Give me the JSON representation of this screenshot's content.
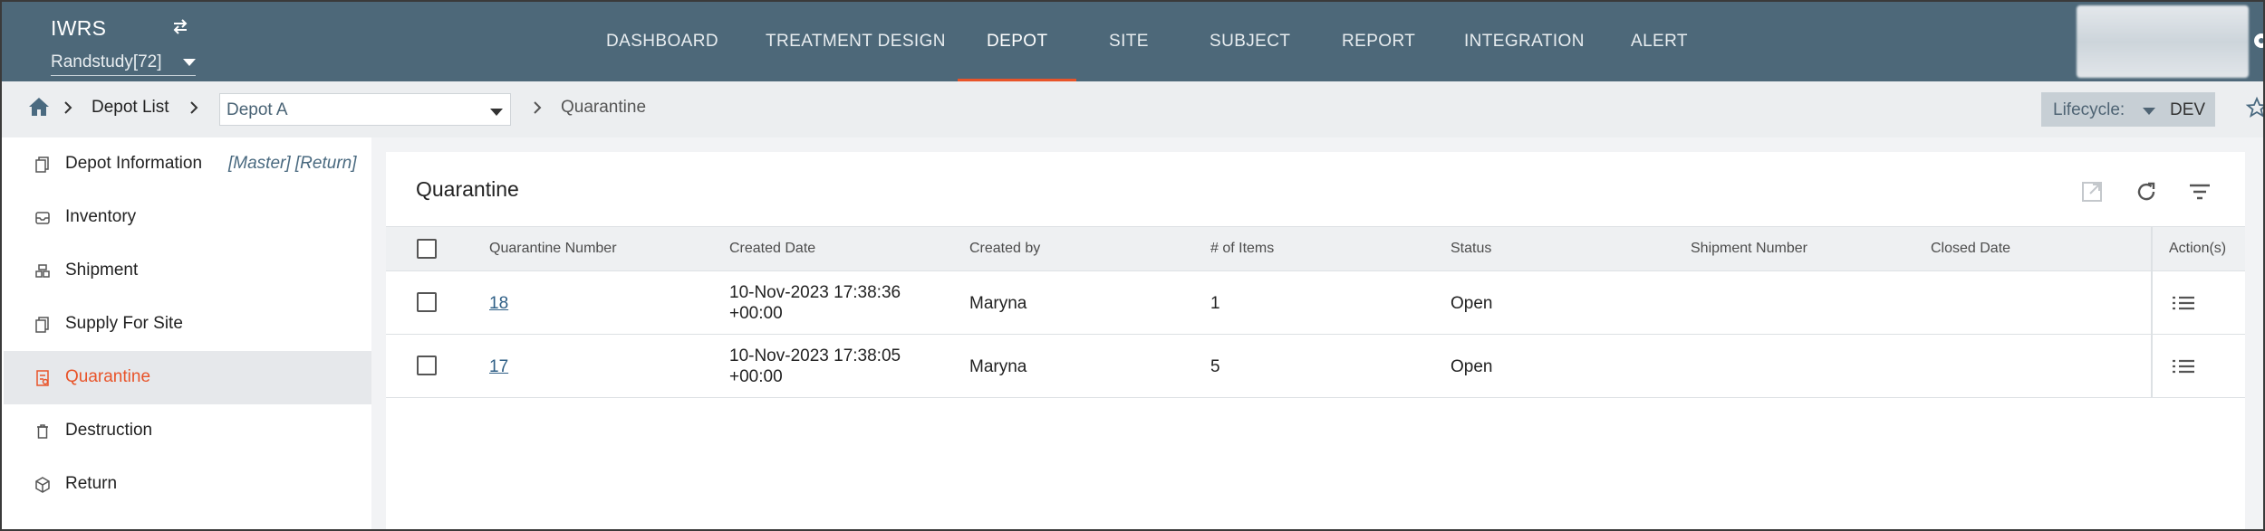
{
  "app": {
    "title": "IWRS",
    "study": "Randstudy[72]"
  },
  "nav": [
    "DASHBOARD",
    "TREATMENT DESIGN",
    "DEPOT",
    "SITE",
    "SUBJECT",
    "REPORT",
    "INTEGRATION",
    "ALERT"
  ],
  "nav_active": "DEPOT",
  "breadcrumb": {
    "depot_list": "Depot List",
    "depot": "Depot A",
    "current": "Quarantine"
  },
  "lifecycle": {
    "label": "Lifecycle:",
    "value": "DEV"
  },
  "sidebar": {
    "items": [
      {
        "label": "Depot Information",
        "tag": "[Master] [Return]",
        "icon": "document-icon"
      },
      {
        "label": "Inventory",
        "icon": "inbox-icon"
      },
      {
        "label": "Shipment",
        "icon": "shipment-icon"
      },
      {
        "label": "Supply For Site",
        "icon": "copy-icon"
      },
      {
        "label": "Quarantine",
        "icon": "quarantine-icon",
        "active": true
      },
      {
        "label": "Destruction",
        "icon": "trash-icon"
      },
      {
        "label": "Return",
        "icon": "box-icon"
      }
    ]
  },
  "panel": {
    "title": "Quarantine",
    "columns": [
      "Quarantine Number",
      "Created Date",
      "Created by",
      "# of Items",
      "Status",
      "Shipment Number",
      "Closed Date",
      "Action(s)"
    ],
    "rows": [
      {
        "number": "18",
        "created_date_1": "10-Nov-2023 17:38:36",
        "created_date_2": "+00:00",
        "created_by": "Maryna",
        "items": "1",
        "status": "Open",
        "shipment": "",
        "closed": ""
      },
      {
        "number": "17",
        "created_date_1": "10-Nov-2023 17:38:05",
        "created_date_2": "+00:00",
        "created_by": "Maryna",
        "items": "5",
        "status": "Open",
        "shipment": "",
        "closed": ""
      }
    ]
  },
  "colors": {
    "nav_bg": "#4d6879",
    "accent": "#e8542a",
    "link": "#2f5f86"
  }
}
